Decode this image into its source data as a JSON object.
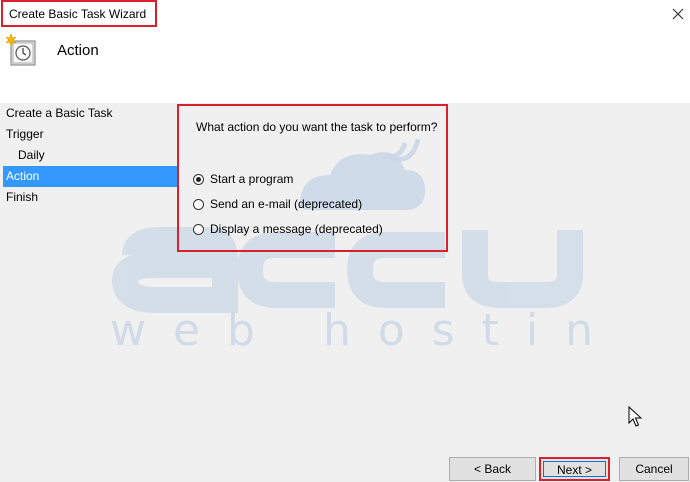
{
  "window": {
    "title": "Create Basic Task Wizard"
  },
  "header": {
    "heading": "Action"
  },
  "sidebar": {
    "items": [
      {
        "label": "Create a Basic Task"
      },
      {
        "label": "Trigger"
      },
      {
        "label": "Daily"
      },
      {
        "label": "Action"
      },
      {
        "label": "Finish"
      }
    ],
    "selected": "Action"
  },
  "main": {
    "question": "What action do you want the task to perform?",
    "options": [
      {
        "label": "Start a program",
        "checked": true
      },
      {
        "label": "Send an e-mail (deprecated)",
        "checked": false
      },
      {
        "label": "Display a message (deprecated)",
        "checked": false
      }
    ]
  },
  "footer": {
    "back_label": "< Back",
    "next_label": "Next >",
    "cancel_label": "Cancel"
  },
  "watermark": {
    "brand": "accu",
    "tagline": "web hosting"
  },
  "colors": {
    "highlight": "#d9202e",
    "selection": "#3399ff",
    "watermark": "#c9d7e6"
  }
}
